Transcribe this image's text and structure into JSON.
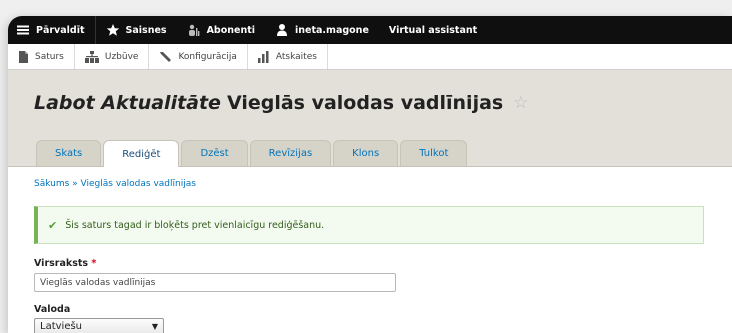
{
  "toolbar": {
    "items": [
      {
        "label": "Pārvaldīt",
        "icon": "menu-icon"
      },
      {
        "label": "Saisnes",
        "icon": "star-icon"
      },
      {
        "label": "Abonenti",
        "icon": "subscribers-icon"
      },
      {
        "label": "ineta.magone",
        "icon": "user-icon"
      },
      {
        "label": "Virtual assistant",
        "icon": ""
      }
    ]
  },
  "tray": {
    "items": [
      {
        "label": "Saturs",
        "icon": "content-icon"
      },
      {
        "label": "Uzbūve",
        "icon": "structure-icon"
      },
      {
        "label": "Konfigurācija",
        "icon": "wrench-icon"
      },
      {
        "label": "Atskaites",
        "icon": "reports-icon"
      }
    ]
  },
  "page": {
    "title_type": "Labot Aktualitāte",
    "title_name": "Vieglās valodas vadlīnijas",
    "star_glyph": "☆"
  },
  "tabs": [
    "Skats",
    "Rediģēt",
    "Dzēst",
    "Revīzijas",
    "Klons",
    "Tulkot"
  ],
  "active_tab": "Rediģēt",
  "breadcrumb": "Sākums » Vieglās valodas vadlīnijas",
  "message": "Šis saturs tagad ir bloķēts pret vienlaicīgu rediģēšanu.",
  "form": {
    "title_label": "Virsraksts",
    "required_mark": "*",
    "title_value": "Vieglās valodas vadlīnijas",
    "language_label": "Valoda",
    "language_value": "Latviešu"
  },
  "colors": {
    "toolbar_bg": "#0f0f0f",
    "link": "#0074bd",
    "header_bg": "#e2e0d8",
    "success_border": "#77b259"
  }
}
